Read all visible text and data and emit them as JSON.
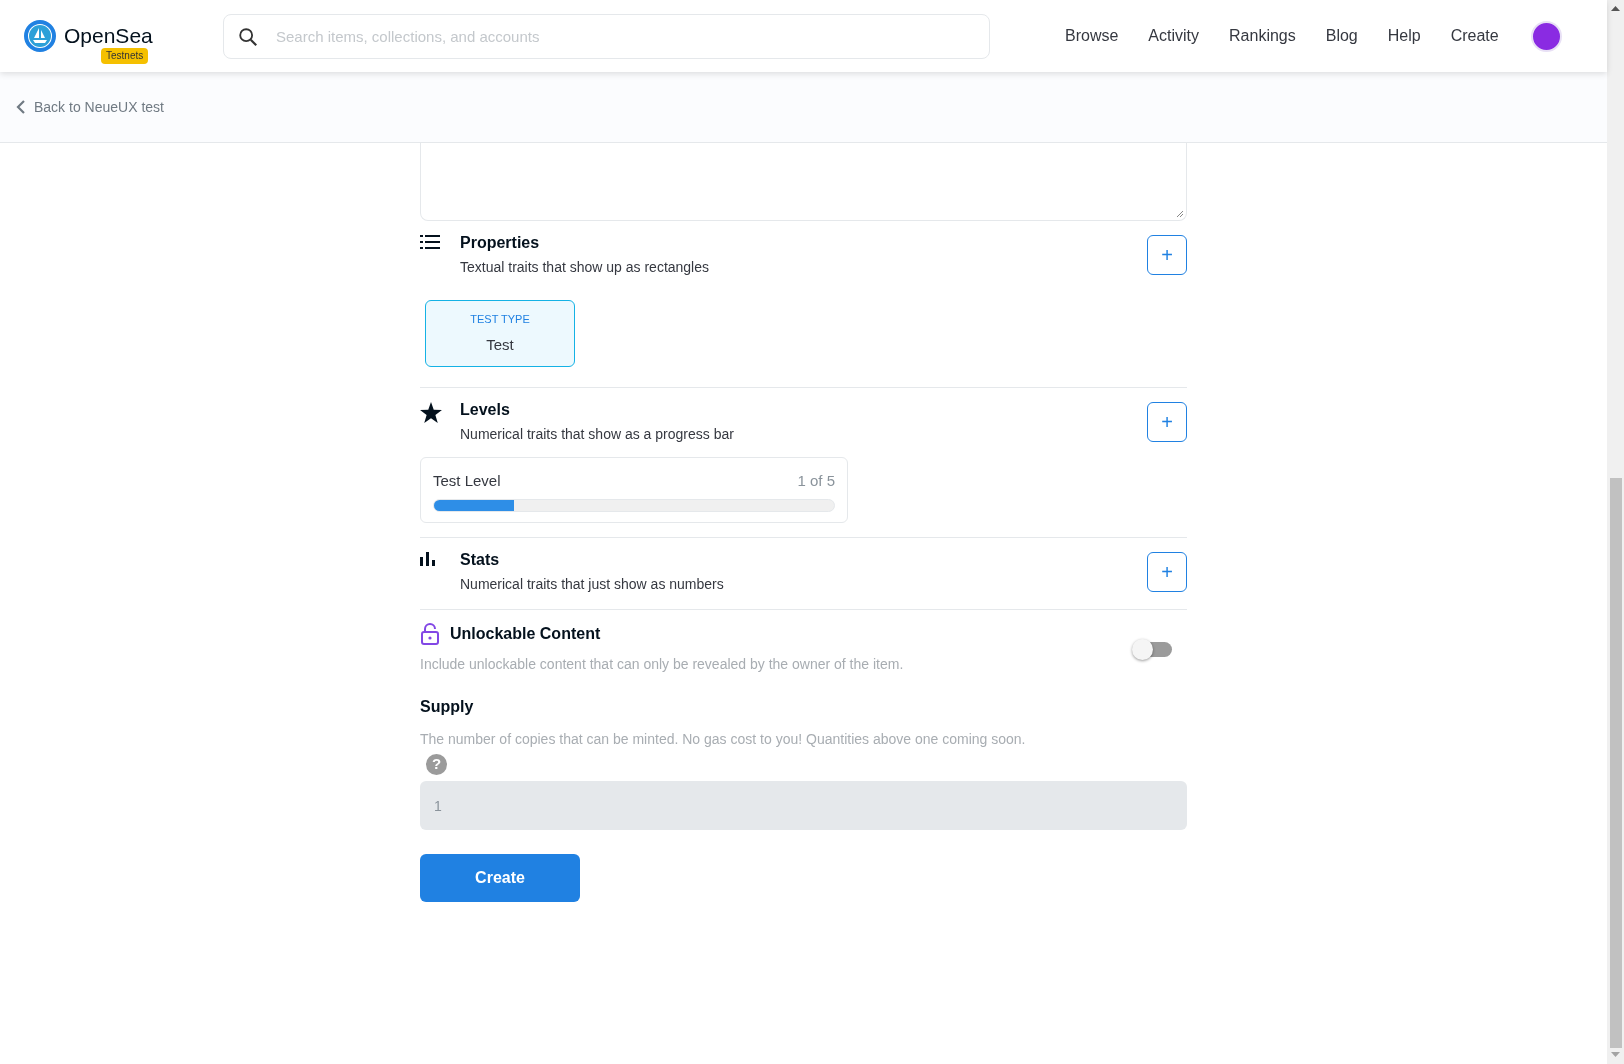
{
  "header": {
    "logo_text": "OpenSea",
    "badge": "Testnets",
    "search": {
      "placeholder": "Search items, collections, and accounts"
    },
    "nav": [
      "Browse",
      "Activity",
      "Rankings",
      "Blog",
      "Help",
      "Create"
    ]
  },
  "back_link": "Back to NeueUX test",
  "sections": [
    {
      "kind": "properties",
      "title": "Properties",
      "description": "Textual traits that show up as rectangles",
      "add": "+",
      "items": [
        {
          "type": "TEST TYPE",
          "value": "Test"
        }
      ]
    },
    {
      "kind": "levels",
      "title": "Levels",
      "description": "Numerical traits that show as a progress bar",
      "add": "+",
      "items": [
        {
          "name": "Test Level",
          "reading": "1 of 5",
          "level": 0.2
        }
      ]
    },
    {
      "kind": "stats",
      "title": "Stats",
      "description": "Numerical traits that just show as numbers",
      "add": "+"
    }
  ],
  "unlockable": {
    "title": "Unlockable Content",
    "description": "Include unlockable content that can only be revealed by the owner of the item.",
    "on": false
  },
  "supply": {
    "title": "Supply",
    "description": "The number of copies that can be minted. No gas cost to you! Quantities above one coming soon.",
    "help": "?",
    "value": "1"
  },
  "create_button": "Create"
}
